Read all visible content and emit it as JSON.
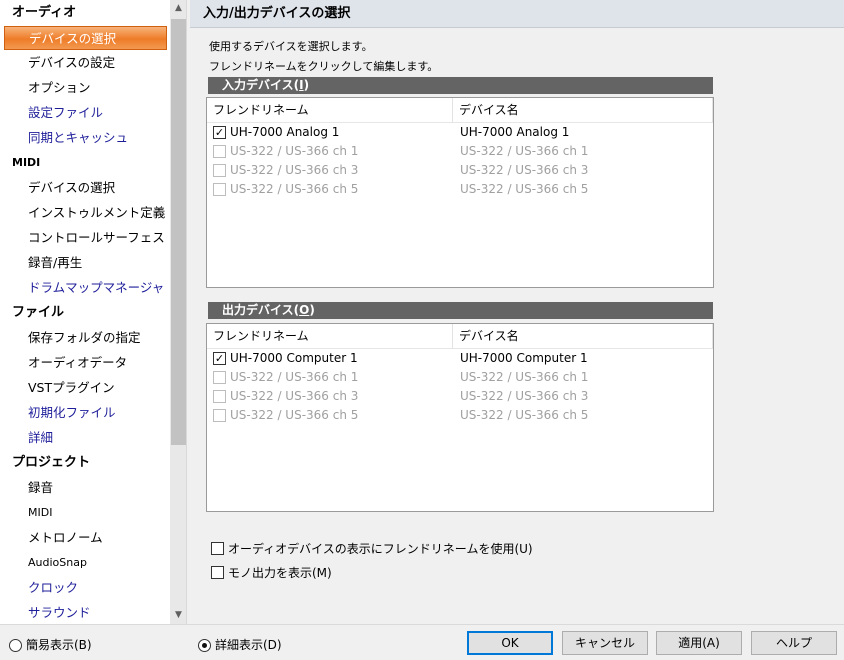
{
  "sidebar": {
    "items": [
      {
        "label": "オーディオ",
        "kind": "cat"
      },
      {
        "label": "デバイスの選択",
        "kind": "item",
        "selected": true
      },
      {
        "label": "デバイスの設定",
        "kind": "item"
      },
      {
        "label": "オプション",
        "kind": "item"
      },
      {
        "label": "設定ファイル",
        "kind": "item",
        "color": "blue"
      },
      {
        "label": "同期とキャッシュ",
        "kind": "item",
        "color": "blue"
      },
      {
        "label": "MIDI",
        "kind": "cat",
        "small": true
      },
      {
        "label": "デバイスの選択",
        "kind": "item"
      },
      {
        "label": "インストゥルメント定義",
        "kind": "item"
      },
      {
        "label": "コントロールサーフェス",
        "kind": "item"
      },
      {
        "label": "録音/再生",
        "kind": "item"
      },
      {
        "label": "ドラムマップマネージャ",
        "kind": "item",
        "color": "blue"
      },
      {
        "label": "ファイル",
        "kind": "cat"
      },
      {
        "label": "保存フォルダの指定",
        "kind": "item"
      },
      {
        "label": "オーディオデータ",
        "kind": "item"
      },
      {
        "label": "VSTプラグイン",
        "kind": "item"
      },
      {
        "label": "初期化ファイル",
        "kind": "item",
        "color": "blue"
      },
      {
        "label": "詳細",
        "kind": "item",
        "color": "blue"
      },
      {
        "label": "プロジェクト",
        "kind": "cat"
      },
      {
        "label": "録音",
        "kind": "item"
      },
      {
        "label": "MIDI",
        "kind": "item",
        "small": true
      },
      {
        "label": "メトロノーム",
        "kind": "item"
      },
      {
        "label": "AudioSnap",
        "kind": "item",
        "small": true
      },
      {
        "label": "クロック",
        "kind": "item",
        "color": "blue"
      },
      {
        "label": "サラウンド",
        "kind": "item",
        "color": "blue"
      }
    ],
    "scroll_up_icon": "chevron-up-icon",
    "scroll_down_icon": "chevron-down-icon"
  },
  "panel": {
    "title": "入力/出力デバイスの選択",
    "desc1": "使用するデバイスを選択します。",
    "desc2": "フレンドリネームをクリックして編集します。",
    "input": {
      "title": "入力デバイス(",
      "accel": "I",
      "title_end": ")",
      "col1": "フレンドリネーム",
      "col2": "デバイス名",
      "rows": [
        {
          "name": "UH-7000 Analog 1",
          "device": "UH-7000 Analog 1",
          "checked": true,
          "enabled": true
        },
        {
          "name": "US-322 / US-366 ch 1",
          "device": "US-322 / US-366 ch 1",
          "checked": false,
          "enabled": false
        },
        {
          "name": "US-322 / US-366 ch 3",
          "device": "US-322 / US-366 ch 3",
          "checked": false,
          "enabled": false
        },
        {
          "name": "US-322 / US-366 ch 5",
          "device": "US-322 / US-366 ch 5",
          "checked": false,
          "enabled": false
        }
      ]
    },
    "output": {
      "title": "出力デバイス(",
      "accel": "O",
      "title_end": ")",
      "col1": "フレンドリネーム",
      "col2": "デバイス名",
      "rows": [
        {
          "name": "UH-7000 Computer 1",
          "device": "UH-7000 Computer 1",
          "checked": true,
          "enabled": true
        },
        {
          "name": "US-322 / US-366 ch 1",
          "device": "US-322 / US-366 ch 1",
          "checked": false,
          "enabled": false
        },
        {
          "name": "US-322 / US-366 ch 3",
          "device": "US-322 / US-366 ch 3",
          "checked": false,
          "enabled": false
        },
        {
          "name": "US-322 / US-366 ch 5",
          "device": "US-322 / US-366 ch 5",
          "checked": false,
          "enabled": false
        }
      ]
    },
    "options": {
      "use_friendly": "オーディオデバイスの表示にフレンドリネームを使用(U)",
      "use_friendly_checked": false,
      "show_mono": "モノ出力を表示(M)",
      "show_mono_checked": false
    }
  },
  "bottom": {
    "simple_view": "簡易表示(B)",
    "simple_selected": false,
    "detail_view": "詳細表示(D)",
    "detail_selected": true,
    "ok": "OK",
    "cancel": "キャンセル",
    "apply": "適用(A)",
    "help": "ヘルプ"
  },
  "colors": {
    "selection": "#ee7c28",
    "link_blue": "#1e1e9a",
    "section_bar": "#646464"
  }
}
